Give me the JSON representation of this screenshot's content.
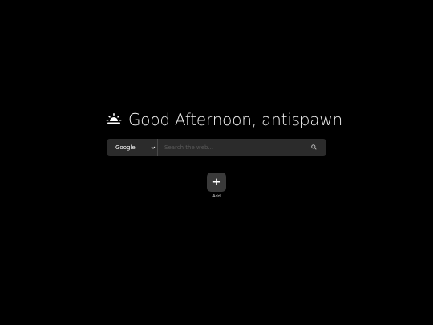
{
  "greeting": {
    "icon": "sunrise-icon",
    "text": "Good Afternoon, antispawn"
  },
  "search": {
    "engine_selected": "Google",
    "placeholder": "Search the web...",
    "submit_icon": "search-icon"
  },
  "shortcuts": {
    "add_icon_glyph": "+",
    "add_label": "Add"
  },
  "colors": {
    "background": "#000000",
    "search_bar": "#2b2b2b",
    "tile": "#3a3a3a",
    "text": "#ffffff"
  }
}
